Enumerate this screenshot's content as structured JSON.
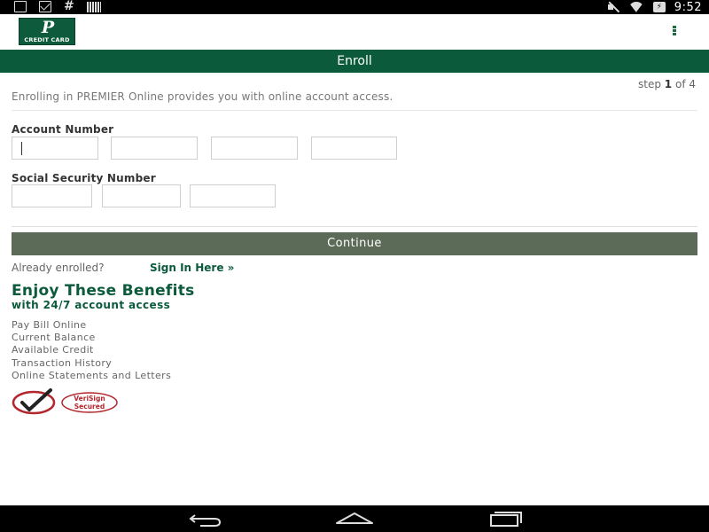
{
  "status_bar": {
    "left_icons": [
      "download-icon",
      "mail-icon",
      "hash-icon",
      "barcode-icon"
    ],
    "hash_glyph": "#",
    "right_icons": [
      "mute-icon",
      "wifi-icon",
      "battery-icon"
    ],
    "battery_glyph": "⚡",
    "time": "9:52"
  },
  "header": {
    "logo_letter": "P",
    "logo_text": "CREDIT CARD",
    "menu_icon": "kebab-menu-icon"
  },
  "enroll": {
    "title": "Enroll",
    "step_prefix": "step ",
    "step_current": "1",
    "step_suffix": " of 4",
    "intro": "Enrolling in PREMIER Online provides you with online account access."
  },
  "form": {
    "account_number_label": "Account Number",
    "ssn_label": "Social Security Number",
    "continue_label": "Continue"
  },
  "signin": {
    "already_text": "Already enrolled?",
    "link_text": "Sign In Here »"
  },
  "benefits": {
    "title": "Enjoy These Benefits",
    "subtitle": "with 24/7 account access",
    "items": [
      "Pay Bill Online",
      "Current Balance",
      "Available Credit",
      "Transaction History",
      "Online Statements and Letters"
    ]
  },
  "badge": {
    "line1": "VeriSign",
    "line2": "Secured"
  },
  "colors": {
    "brand_green": "#0b5a3b",
    "button_gray_green": "#5c6b58"
  }
}
